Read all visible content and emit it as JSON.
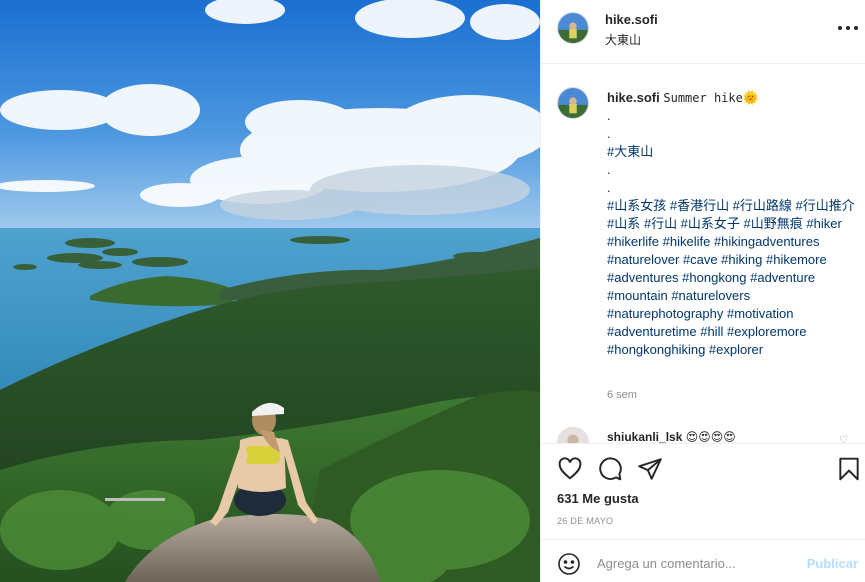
{
  "post": {
    "username": "hike.sofi",
    "location": "大東山",
    "caption_text": "Summer hike",
    "caption_emoji": "🌞",
    "caption_dots_1": ".",
    "caption_dots_2": ".",
    "caption_tag_1": "#大東山",
    "caption_dots_3": ".",
    "caption_dots_4": ".",
    "hashtags": "#山系女孩 #香港行山 #行山路線 #行山推介 #山系 #行山 #山系女子 #山野無痕 #hiker #hikerlife #hikelife #hikingadventures #naturelover #cave #hiking #hikemore #adventures #hongkong #adventure #mountain #naturelovers #naturephotography #motivation #adventuretime #hill #exploremore #hongkonghiking #explorer",
    "time_ago": "6 sem"
  },
  "comment2": {
    "username": "shiukanli_lsk",
    "emojis": "😍😍😍😍"
  },
  "actions": {
    "likes": "631 Me gusta",
    "date": "26 DE MAYO",
    "like_icon": "heart-icon",
    "comment_icon": "comment-icon",
    "share_icon": "share-icon",
    "save_icon": "bookmark-icon"
  },
  "add_comment": {
    "placeholder": "Agrega un comentario...",
    "publish_label": "Publicar"
  },
  "colors": {
    "hashtag": "#00376b",
    "publish_disabled": "#b2dffc",
    "secondary_text": "#8e8e8e"
  }
}
